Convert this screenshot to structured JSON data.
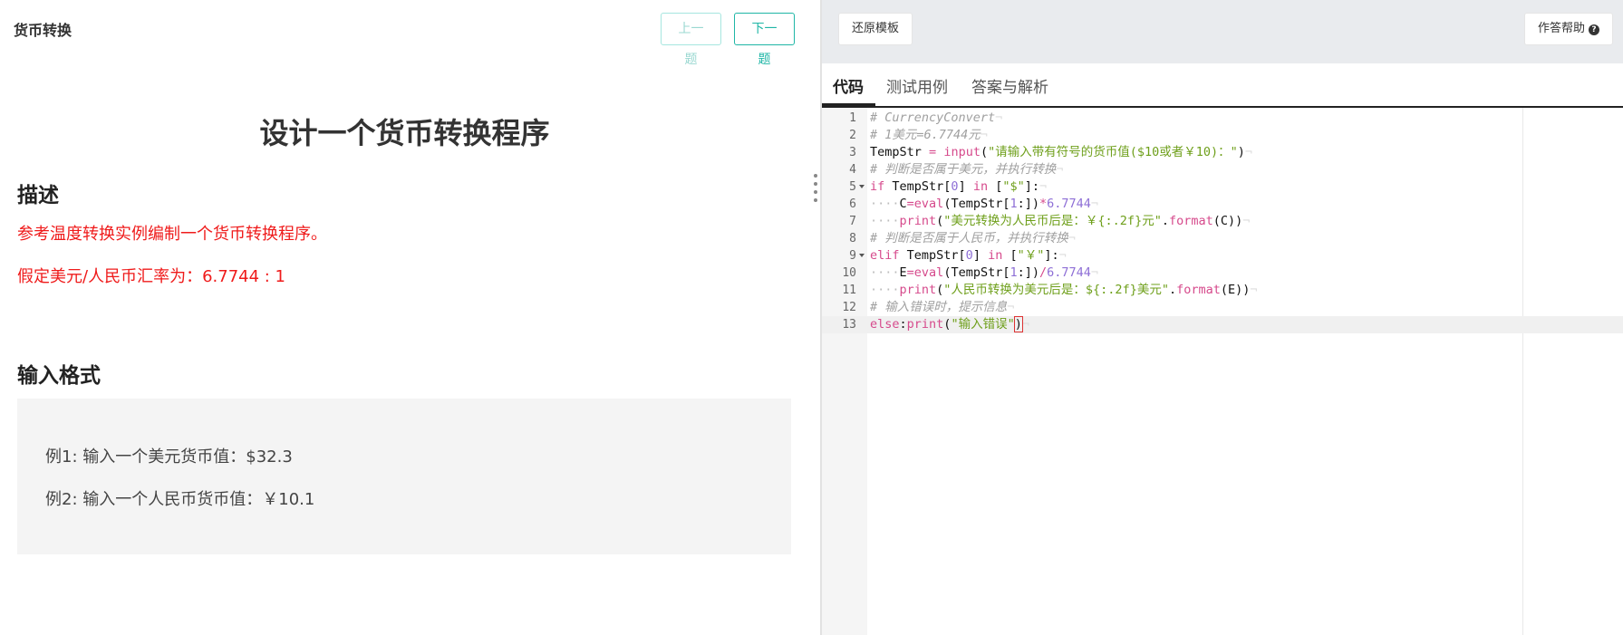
{
  "problem": {
    "breadcrumb": "货币转换",
    "prev_label": "上一题",
    "next_label": "下一题",
    "title": "设计一个货币转换程序",
    "description_heading": "描述",
    "description_lines": [
      "参考温度转换实例编制一个货币转换程序。",
      "假定美元/人民币汇率为：6.7744 : 1"
    ],
    "input_heading": "输入格式",
    "input_samples": [
      "例1: 输入一个美元货币值：$32.3",
      "例2: 输入一个人民币货币值：￥10.1"
    ]
  },
  "editor_toolbar": {
    "restore_label": "还原模板",
    "help_label": "作答帮助"
  },
  "tabs": [
    {
      "label": "代码",
      "active": true
    },
    {
      "label": "测试用例",
      "active": false
    },
    {
      "label": "答案与解析",
      "active": false
    }
  ],
  "code": {
    "active_line": 13,
    "lines": [
      "# CurrencyConvert",
      "# 1美元=6.7744元",
      "TempStr = input(\"请输入带有符号的货币值($10或者￥10)：\")",
      "# 判断是否属于美元，并执行转换",
      "if TempStr[0] in [\"$\"]:",
      "    C=eval(TempStr[1:])*6.7744",
      "    print(\"美元转换为人民币后是：￥{:.2f}元\".format(C))",
      "# 判断是否属于人民币，并执行转换",
      "elif TempStr[0] in [\"￥\"]:",
      "    E=eval(TempStr[1:])/6.7744",
      "    print(\"人民币转换为美元后是：${:.2f}美元\".format(E))",
      "# 输入错误时，提示信息",
      "else:print(\"输入错误\")"
    ],
    "fold_lines": [
      5,
      9
    ]
  }
}
